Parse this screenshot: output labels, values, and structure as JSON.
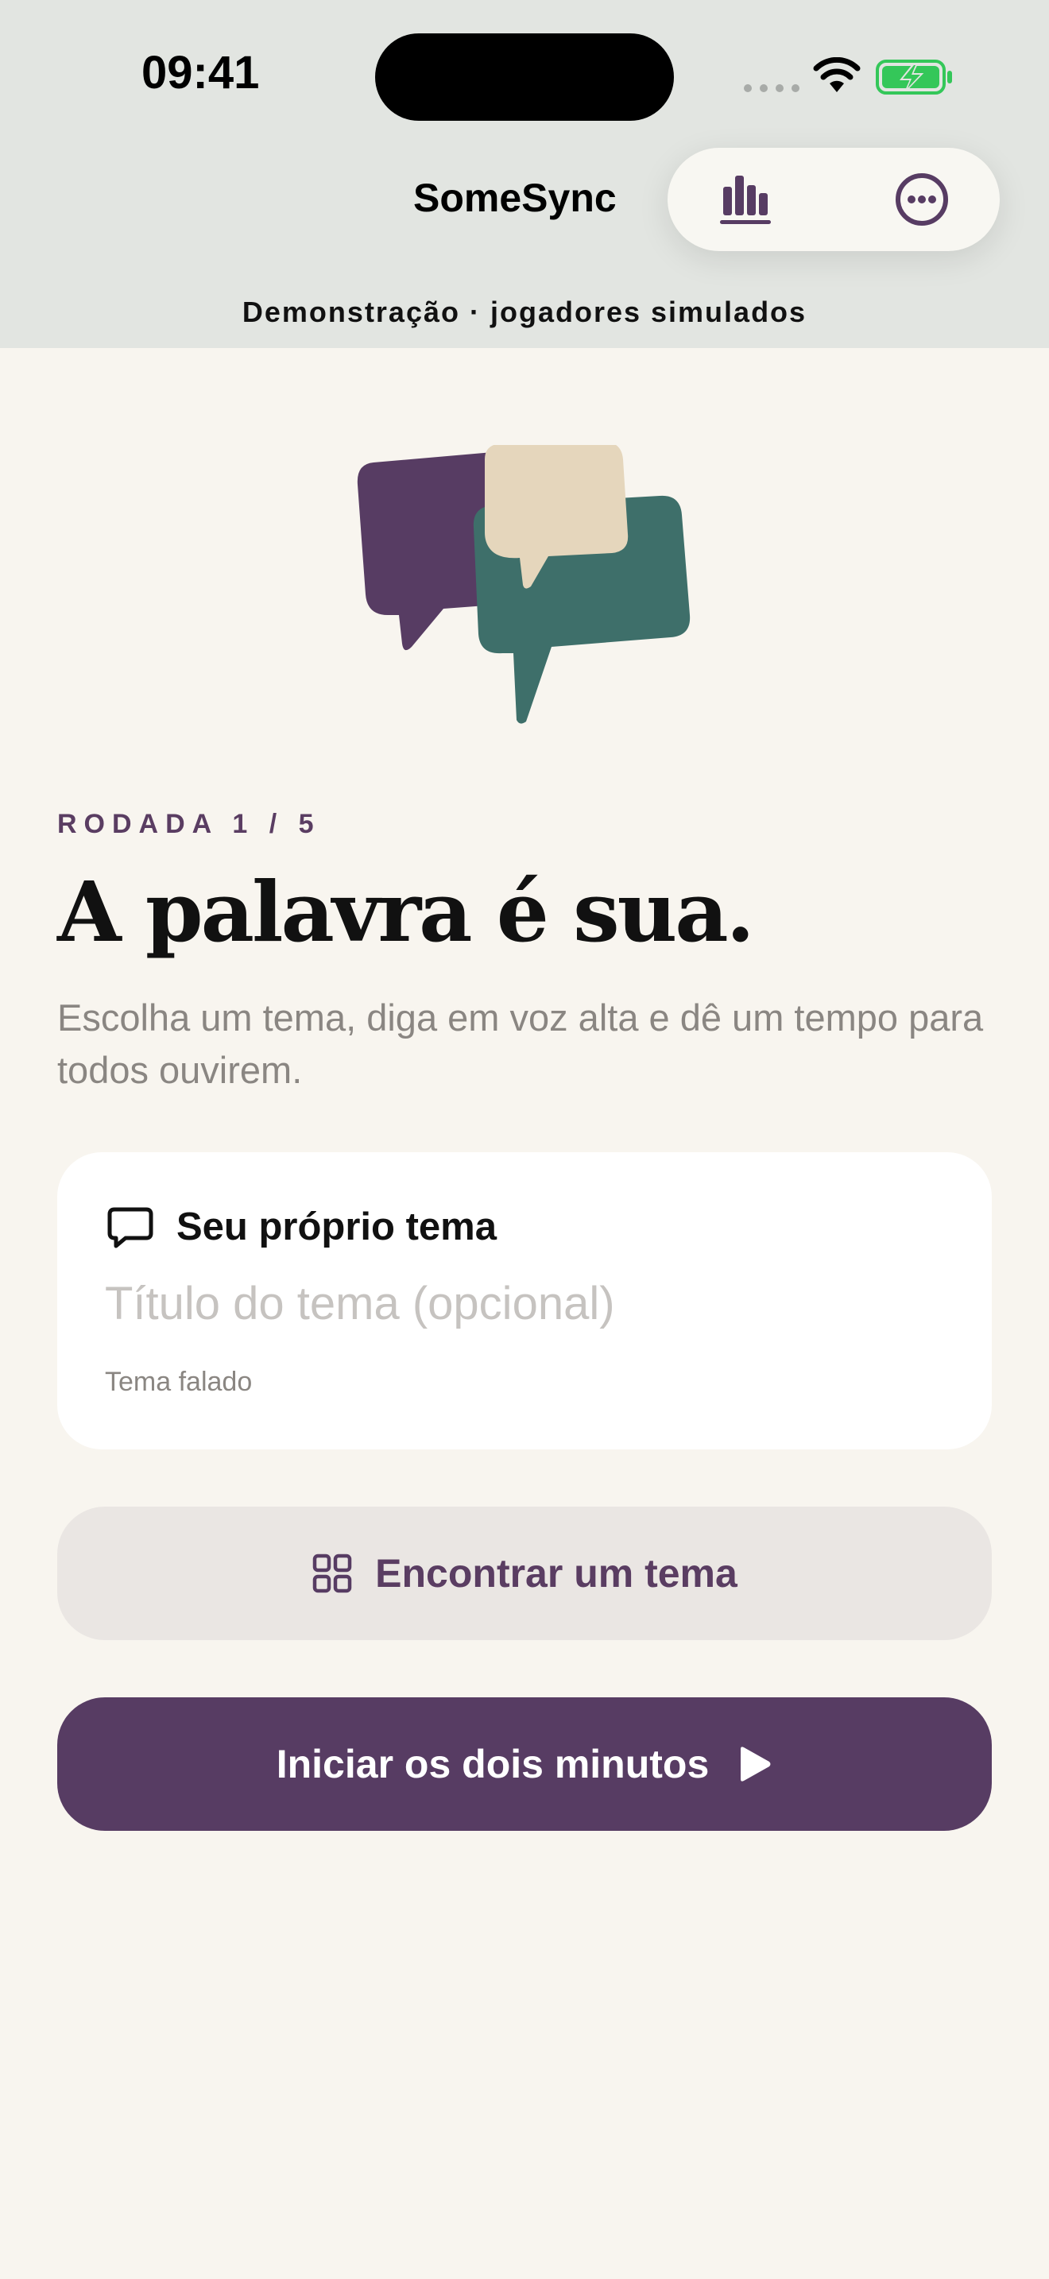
{
  "status_bar": {
    "time": "09:41"
  },
  "header": {
    "app_title": "SomeSync",
    "demo_banner": "Demonstração · jogadores simulados",
    "actions": [
      {
        "icon": "bar-chart-icon"
      },
      {
        "icon": "more-options-icon"
      }
    ]
  },
  "hero": {
    "illustration": "chat-bubbles-illustration"
  },
  "round": {
    "label": "RODADA 1 / 5"
  },
  "main": {
    "headline": "A palavra é sua.",
    "subtitle": "Escolha um tema, diga em voz alta e dê um tempo para todos ouvirem."
  },
  "topic_card": {
    "icon": "speech-bubble-icon",
    "title": "Seu próprio tema",
    "input_value": "",
    "input_placeholder": "Título do tema (opcional)",
    "caption": "Tema falado"
  },
  "buttons": {
    "find_topic": {
      "label": "Encontrar um tema",
      "icon": "grid-icon"
    },
    "start": {
      "label": "Iniciar os dois minutos",
      "icon": "play-icon"
    }
  },
  "colors": {
    "accent": "#573C63",
    "header_bg": "#E2E5E1",
    "page_bg": "#F8F5EF",
    "bubble_purple": "#573C63",
    "bubble_green": "#3E6F6A",
    "bubble_beige": "#E5D6BC",
    "battery_green": "#34C759"
  }
}
